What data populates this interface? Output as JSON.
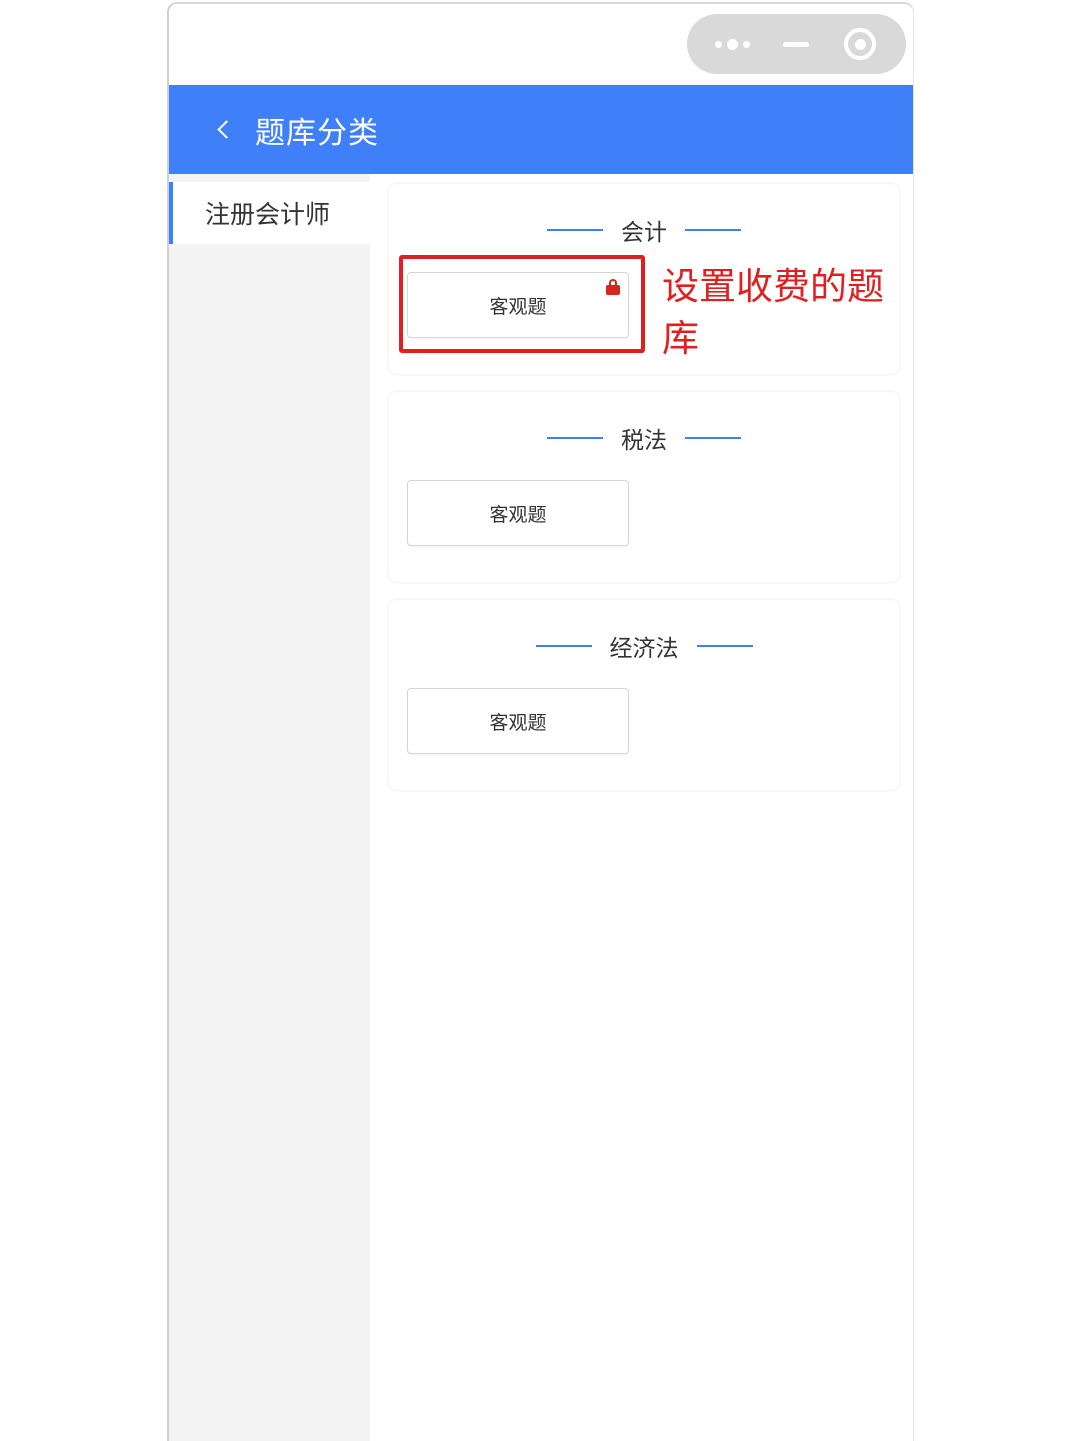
{
  "capsule": {
    "more_icon": "more-dots-icon",
    "minimize_icon": "minimize-icon",
    "close_icon": "target-close-icon"
  },
  "navbar": {
    "back_icon": "chevron-left-icon",
    "title": "题库分类",
    "bg_color": "#3f7ff7"
  },
  "sidebar": {
    "items": [
      {
        "label": "注册会计师",
        "active": true
      }
    ]
  },
  "sections": [
    {
      "title": "会计",
      "button_label": "客观题",
      "locked": true
    },
    {
      "title": "税法",
      "button_label": "客观题",
      "locked": false
    },
    {
      "title": "经济法",
      "button_label": "客观题",
      "locked": false
    }
  ],
  "annotation": {
    "text": "设置收费的题库",
    "color": "#e02020"
  }
}
